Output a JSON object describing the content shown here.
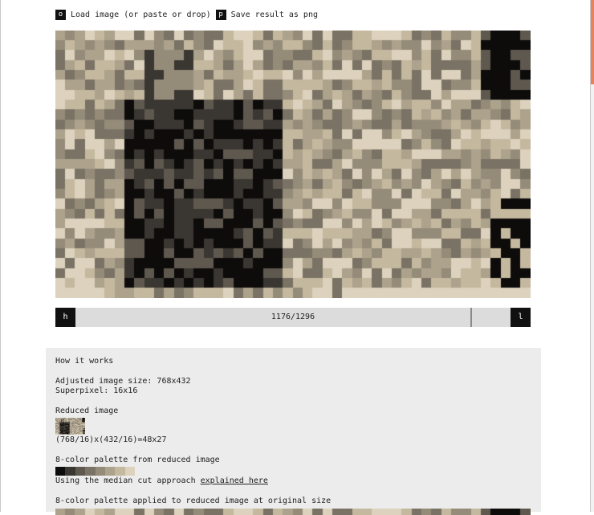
{
  "toolbar": {
    "load_key": "o",
    "load_label": "Load image (or paste or drop)",
    "save_key": "p",
    "save_label": "Save result as png"
  },
  "slider": {
    "left_key": "h",
    "right_key": "l",
    "value_text": "1176/1296",
    "current": 1176,
    "total": 1296
  },
  "info": {
    "heading": "How it works",
    "adjusted_size": "Adjusted image size: 768x432",
    "superpixel": "Superpixel: 16x16",
    "reduced_heading": "Reduced image",
    "reduced_formula": "(768/16)x(432/16)=48x27",
    "palette_heading": "8-color palette from reduced image",
    "median_cut_text": "Using the median cut approach ",
    "median_cut_link": "explained here",
    "applied_heading": "8-color palette applied to reduced image at original size"
  },
  "palette": [
    "#0d0c0b",
    "#3a3631",
    "#5e584f",
    "#7a7264",
    "#958b79",
    "#ada28c",
    "#c4b89f",
    "#dcd2bd"
  ],
  "icons": {
    "load": "key-o-badge",
    "save": "key-p-badge",
    "prev": "key-h-badge",
    "next": "key-l-badge"
  }
}
